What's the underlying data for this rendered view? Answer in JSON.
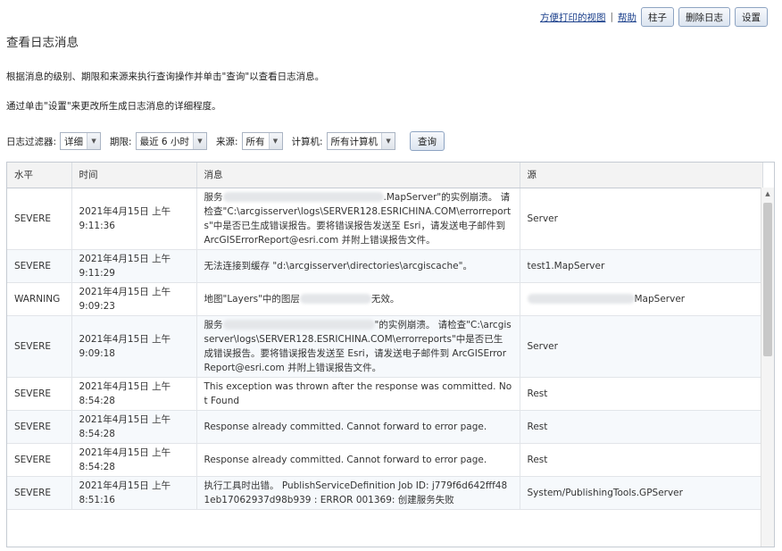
{
  "toplinks": {
    "print_view": "方便打印的视图",
    "sep": "|",
    "help": "帮助",
    "columns": "柱子",
    "delete_logs": "删除日志",
    "settings": "设置"
  },
  "page": {
    "title": "查看日志消息",
    "desc1": "根据消息的级别、期限和来源来执行查询操作并单击\"查询\"以查看日志消息。",
    "desc2": "通过单击\"设置\"来更改所生成日志消息的详细程度。"
  },
  "filters": {
    "filter_label": "日志过滤器:",
    "filter_value": "详细",
    "age_label": "期限:",
    "age_value": "最近 6 小时",
    "source_label": "来源:",
    "source_value": "所有",
    "machine_label": "计算机:",
    "machine_value": "所有计算机",
    "query": "查询"
  },
  "table": {
    "headers": [
      "水平",
      "时间",
      "消息",
      "源"
    ],
    "rows": [
      {
        "level": "SEVERE",
        "time": "2021年4月15日 上午 9:11:36",
        "msg_a": "服务",
        "msg_b": ".MapServer\"的实例崩溃。 请检查\"C:\\arcgisserver\\logs\\SERVER128.ESRICHINA.COM\\errorreports\"中是否已生成错误报告。要将错误报告发送至 Esri，请发送电子邮件到 ArcGISErrorReport@esri.com 并附上错误报告文件。",
        "source": "Server"
      },
      {
        "level": "SEVERE",
        "time": "2021年4月15日 上午 9:11:29",
        "msg_a": "无法连接到缓存 \"d:\\arcgisserver\\directories\\arcgiscache\"。",
        "msg_b": "",
        "source": "test1.MapServer"
      },
      {
        "level": "WARNING",
        "time": "2021年4月15日 上午 9:09:23",
        "msg_a": "地图\"Layers\"中的图层",
        "msg_b": "无效。",
        "source": "MapServer"
      },
      {
        "level": "SEVERE",
        "time": "2021年4月15日 上午 9:09:18",
        "msg_a": "服务",
        "msg_b": "\"的实例崩溃。 请检查\"C:\\arcgisserver\\logs\\SERVER128.ESRICHINA.COM\\errorreports\"中是否已生成错误报告。要将错误报告发送至 Esri，请发送电子邮件到 ArcGISErrorReport@esri.com 并附上错误报告文件。",
        "source": "Server"
      },
      {
        "level": "SEVERE",
        "time": "2021年4月15日 上午 8:54:28",
        "msg_a": "This exception was thrown after the response was committed. Not Found",
        "msg_b": "",
        "source": "Rest"
      },
      {
        "level": "SEVERE",
        "time": "2021年4月15日 上午 8:54:28",
        "msg_a": "Response already committed. Cannot forward to error page.",
        "msg_b": "",
        "source": "Rest"
      },
      {
        "level": "SEVERE",
        "time": "2021年4月15日 上午 8:54:28",
        "msg_a": "Response already committed. Cannot forward to error page.",
        "msg_b": "",
        "source": "Rest"
      },
      {
        "level": "SEVERE",
        "time": "2021年4月15日 上午 8:51:16",
        "msg_a": "执行工具时出错。 PublishServiceDefinition Job ID: j779f6d642fff481eb17062937d98b939 : ERROR 001369: 创建服务失败",
        "msg_b": "",
        "source": "System/PublishingTools.GPServer"
      }
    ]
  }
}
